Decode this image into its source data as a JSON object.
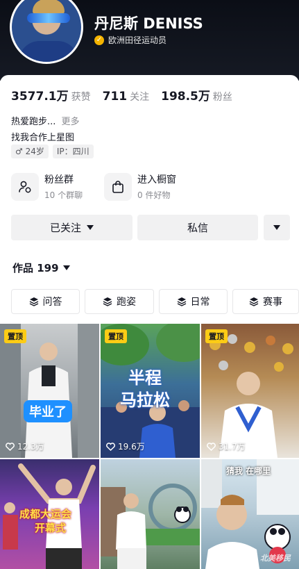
{
  "profile": {
    "name": "丹尼斯 DENISS",
    "verification": "欧洲田径运动员"
  },
  "stats": [
    {
      "value": "3577.1万",
      "label": "获赞"
    },
    {
      "value": "711",
      "label": "关注"
    },
    {
      "value": "198.5万",
      "label": "粉丝"
    }
  ],
  "bio": {
    "line1": "热爱跑步...",
    "more": "更多",
    "line2": "找我合作上星图",
    "tags": [
      "♂ 24岁",
      "IP：四川"
    ]
  },
  "features": [
    {
      "title": "粉丝群",
      "subtitle": "10 个群聊",
      "icon": "fan-group-icon"
    },
    {
      "title": "进入橱窗",
      "subtitle": "0 件好物",
      "icon": "shopping-bag-icon"
    }
  ],
  "actions": {
    "following_label": "已关注",
    "message_label": "私信"
  },
  "works": {
    "label": "作品 199"
  },
  "collections": [
    "问答",
    "跑姿",
    "日常",
    "赛事"
  ],
  "videos": [
    {
      "pinned": "置顶",
      "likes": "12.3万",
      "caption": "毕业了"
    },
    {
      "pinned": "置顶",
      "likes": "19.6万",
      "caption_line1": "半程",
      "caption_line2": "马拉松"
    },
    {
      "pinned": "置顶",
      "likes": "31.7万"
    },
    {
      "caption_line1": "成都大运会",
      "caption_line2": "开幕式"
    },
    {},
    {
      "caption": "猜我 在哪里"
    }
  ],
  "watermark": "北美移民",
  "colors": {
    "pin_badge": "#fccc15",
    "verify_badge": "#f5b400",
    "header_bg": "#0b0e16"
  }
}
